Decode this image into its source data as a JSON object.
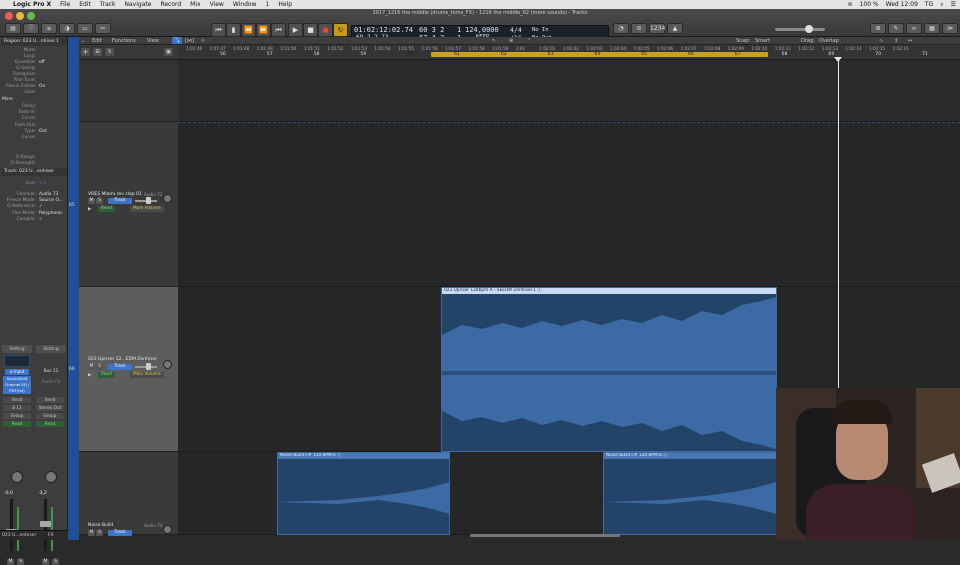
{
  "menubar": {
    "apple": "",
    "app_name": "Logic Pro X",
    "items": [
      "File",
      "Edit",
      "Track",
      "Navigate",
      "Record",
      "Mix",
      "View",
      "Window",
      "1",
      "Help"
    ],
    "status": {
      "battery": "100 %",
      "clock": "Wed 12:09",
      "user": "TG"
    }
  },
  "window": {
    "title": "2017_1216 the middle (drums_toms_FX) - 1216 the middle_02 (more sounds) - Tracks"
  },
  "transport": {
    "rewind": "⏮",
    "back": "⏪",
    "forward": "⏩",
    "stop_start": "⏮",
    "play": "▶",
    "stop": "■",
    "record": "●",
    "cycle": "↻"
  },
  "lcd": {
    "time": "01:02:12:02.74",
    "subtime": "69  2  2     73",
    "bars_top": "60  3  2",
    "bars_bottom": "67  4  2",
    "beat_top": "1",
    "beat_bottom": "1",
    "tempo": "124,0000",
    "tempo_mode": "KEEP",
    "signature": "4/4",
    "division": "/16",
    "in": "No In",
    "out": "No Out"
  },
  "toolbar": {
    "edit": "Edit",
    "functions": "Functions",
    "view": "View",
    "snap_label": "Snap:",
    "snap_value": "Smart",
    "drag_label": "Drag:",
    "drag_value": "Overlap"
  },
  "inspector": {
    "region_header": "Region: 023 U...nhiser.1",
    "rows": [
      {
        "k": "Mute:",
        "v": ""
      },
      {
        "k": "Loop:",
        "v": ""
      },
      {
        "k": "Quantize:",
        "v": "off"
      },
      {
        "k": "Q-Swing:",
        "v": ""
      },
      {
        "k": "Transpose:",
        "v": ""
      },
      {
        "k": "Fine Tune:",
        "v": ""
      },
      {
        "k": "Flex & Follow:",
        "v": "On"
      },
      {
        "k": "Gain:",
        "v": ""
      }
    ],
    "more": "More",
    "more_rows": [
      {
        "k": "Delay:",
        "v": ""
      },
      {
        "k": "Fade In:",
        "v": ""
      },
      {
        "k": "Curve:",
        "v": ""
      },
      {
        "k": "Fade Out:",
        "v": ""
      },
      {
        "k": "Type:",
        "v": "Out"
      },
      {
        "k": "Curve:",
        "v": ""
      },
      {
        "k": "Q-Range:",
        "v": ""
      },
      {
        "k": "Q-Strength:",
        "v": ""
      }
    ],
    "track_header": "Track: 023 U...enhiser",
    "track_rows": [
      {
        "k": "Icon:",
        "v": ""
      },
      {
        "k": "Channel:",
        "v": "Audio 73"
      },
      {
        "k": "Freeze Mode:",
        "v": "Source O..."
      },
      {
        "k": "Q-Reference:",
        "v": "✓"
      },
      {
        "k": "Flex Mode:",
        "v": "Polyphonic"
      },
      {
        "k": "Compile:",
        "v": "✓"
      }
    ],
    "setting1": "Setting",
    "setting2": "Setting",
    "eq1": "SoundShift Channel EQ / PDT(tst)",
    "bus": "Bus 11",
    "audio_fx": "Audio FX",
    "send": "Send",
    "bus2": "B 11",
    "stereo_out": "Stereo Out",
    "group": "Group",
    "read1": "Read",
    "read2": "Read",
    "vol1": "-0,0",
    "vol2": "-3,2",
    "ms": [
      "M",
      "S",
      "M",
      "S"
    ],
    "bottom_name": "023 U...enhiser",
    "bottom_fx": "FX"
  },
  "track_headers": [
    {
      "number": "",
      "name": "VOES Miami rev clap 01",
      "sub": "Audio 72",
      "track_btn": "Track",
      "read": "Read",
      "param": "Main Volume",
      "sel": false
    },
    {
      "number": "66",
      "name": "023 Upriser 12...EDM Zenhiser",
      "sub": "",
      "track_btn": "Track",
      "read": "Read",
      "param": "Main Volume",
      "sel": true
    },
    {
      "number": "",
      "name": "Noise Build",
      "sub": "Audio 74",
      "track_btn": "Track",
      "read": "",
      "param": "",
      "sel": false
    }
  ],
  "ruler": {
    "timecodes": [
      "1:01:46",
      "1:01:47",
      "1:01:48",
      "1:01:49",
      "1:01:50",
      "1:01:51",
      "1:01:52",
      "1:01:53",
      "1:01:54",
      "1:01:55",
      "1:01:56",
      "1:01:57",
      "1:01:58",
      "1:01:59",
      "1:02",
      "1:02:01",
      "1:02:02",
      "1:02:03",
      "1:02:04",
      "1:02:05",
      "1:02:06",
      "1:02:07",
      "1:02:08",
      "1:02:09",
      "1:02:10",
      "1:02:11",
      "1:02:12",
      "1:02:13",
      "1:02:14",
      "1:02:15",
      "1:02:16"
    ],
    "bars": [
      "56",
      "57",
      "58",
      "59",
      "60",
      "61",
      "62",
      "63",
      "64",
      "65",
      "66",
      "67",
      "68",
      "69",
      "70",
      "71"
    ]
  },
  "regions": [
    {
      "label": "023 Upriser 128bpm A - SEEDM Zenhiser.1  ⓒ",
      "selected": true
    },
    {
      "label": "Noise Build F# 120 BPM.6  ⓒ",
      "selected": false
    },
    {
      "label": "Noise Build F# 120 BPM.6  ⓒ",
      "selected": false
    }
  ],
  "colors": {
    "accent": "#3b74c8",
    "cycle": "#c7a21e",
    "region": "#234468",
    "record": "#d33a2a"
  }
}
